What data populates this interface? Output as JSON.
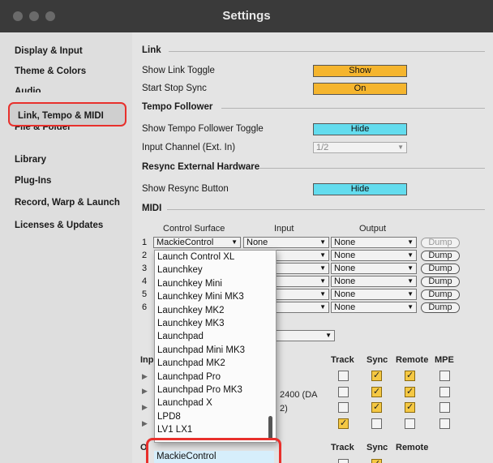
{
  "window": {
    "title": "Settings"
  },
  "sidebar": {
    "items": [
      {
        "label": "Display & Input"
      },
      {
        "label": "Theme & Colors"
      },
      {
        "label": "Audio"
      },
      {
        "label": "Link, Tempo & MIDI",
        "active": true
      },
      {
        "label": "File & Folder"
      },
      {
        "label": "Library"
      },
      {
        "label": "Plug-Ins"
      },
      {
        "label": "Record, Warp & Launch"
      },
      {
        "label": "Licenses & Updates"
      }
    ]
  },
  "link": {
    "section": "Link",
    "show_link_toggle_label": "Show Link Toggle",
    "show_link_toggle_value": "Show",
    "start_stop_sync_label": "Start Stop Sync",
    "start_stop_sync_value": "On"
  },
  "tempo": {
    "section": "Tempo Follower",
    "show_toggle_label": "Show Tempo Follower Toggle",
    "show_toggle_value": "Hide",
    "input_channel_label": "Input Channel (Ext. In)",
    "input_channel_value": "1/2"
  },
  "resync": {
    "section": "Resync External Hardware",
    "show_button_label": "Show Resync Button",
    "show_button_value": "Hide"
  },
  "midi": {
    "section": "MIDI",
    "headers": {
      "control_surface": "Control Surface",
      "input": "Input",
      "output": "Output"
    },
    "rows": [
      {
        "num": "1",
        "surface": "MackieControl",
        "input": "None",
        "output": "None",
        "dump": "Dump"
      },
      {
        "num": "2",
        "output": "None",
        "dump": "Dump"
      },
      {
        "num": "3",
        "output": "None",
        "dump": "Dump"
      },
      {
        "num": "4",
        "output": "None",
        "dump": "Dump"
      },
      {
        "num": "5",
        "output": "None",
        "dump": "Dump"
      },
      {
        "num": "6",
        "output": "None",
        "dump": "Dump"
      }
    ],
    "ports_header": {
      "input_prefix": "Inp",
      "track": "Track",
      "sync": "Sync",
      "remote": "Remote",
      "mpe": "MPE"
    },
    "port_fragments": [
      "2400 (DA",
      "2)"
    ],
    "output_ports_header": {
      "prefix": "O",
      "track": "Track",
      "sync": "Sync",
      "remote": "Remote"
    },
    "ports": [
      {
        "track": false,
        "sync": true,
        "remote": true,
        "mpe": false
      },
      {
        "track": false,
        "sync": true,
        "remote": true,
        "mpe": false
      },
      {
        "track": false,
        "sync": true,
        "remote": true,
        "mpe": false
      },
      {
        "track": true,
        "sync": false,
        "remote": false,
        "mpe": false
      }
    ]
  },
  "popup": {
    "items": [
      "Launch Control XL",
      "Launchkey",
      "Launchkey Mini",
      "Launchkey Mini MK3",
      "Launchkey MK2",
      "Launchkey MK3",
      "Launchpad",
      "Launchpad Mini MK3",
      "Launchpad MK2",
      "Launchpad Pro",
      "Launchpad Pro MK3",
      "Launchpad X",
      "LPD8",
      "LV1 LX1"
    ],
    "highlighted": "MackieControl"
  },
  "colors": {
    "accent_orange": "#f5b52e",
    "accent_cyan": "#63dcee",
    "annotation_red": "#e8302c"
  }
}
